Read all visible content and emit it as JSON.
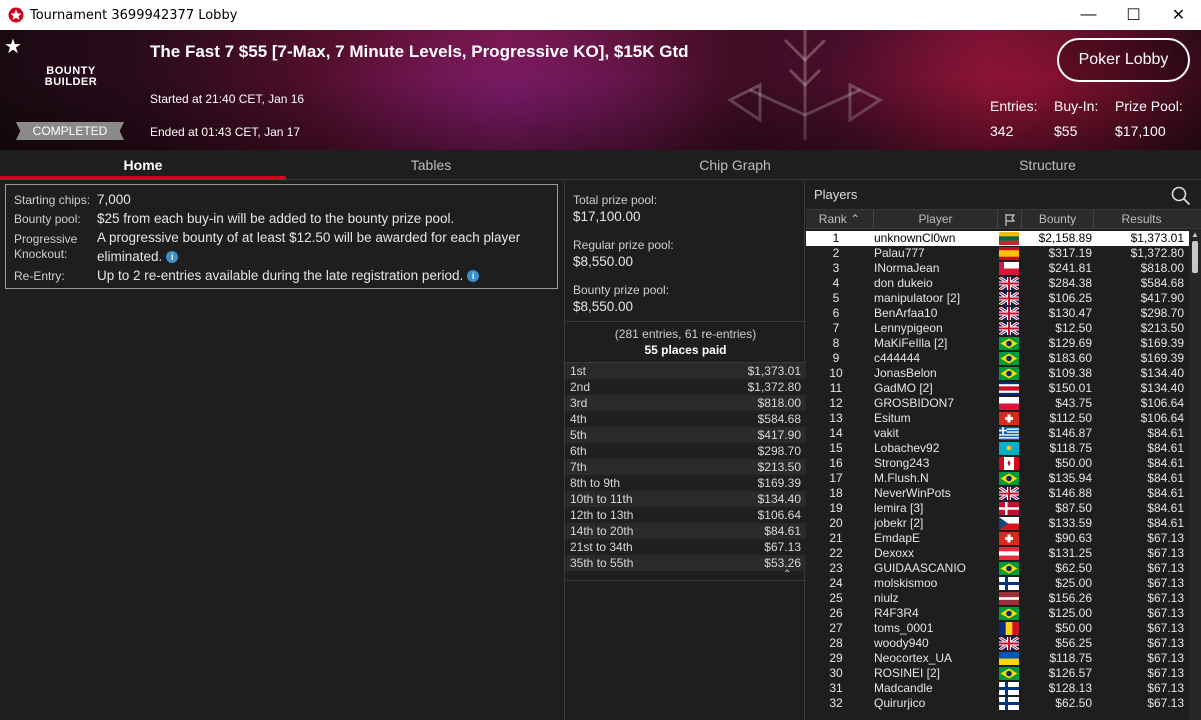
{
  "window": {
    "title": "Tournament 3699942377 Lobby",
    "controls": [
      "—",
      "☐",
      "✕"
    ]
  },
  "banner": {
    "brand_logo_line1": "BOUNTY",
    "brand_logo_line2": "BUILDER",
    "status": "COMPLETED",
    "title": "The Fast 7 $55 [7-Max, 7 Minute Levels, Progressive KO], $15K Gtd",
    "started": "Started at 21:40 CET, Jan 16",
    "ended": "Ended at 01:43 CET, Jan 17",
    "poker_lobby_label": "Poker Lobby",
    "stats": {
      "entries_label": "Entries:",
      "entries": "342",
      "buyin_label": "Buy-In:",
      "buyin": "$55",
      "prizepool_label": "Prize Pool:",
      "prizepool": "$17,100"
    }
  },
  "tabs": [
    {
      "label": "Home",
      "active": true
    },
    {
      "label": "Tables",
      "active": false
    },
    {
      "label": "Chip Graph",
      "active": false
    },
    {
      "label": "Structure",
      "active": false
    }
  ],
  "info": {
    "starting_chips_label": "Starting chips:",
    "starting_chips": "7,000",
    "bounty_pool_label": "Bounty pool:",
    "bounty_pool": "$25 from each buy-in will be added to the bounty prize pool.",
    "progressive_label_1": "Progressive",
    "progressive_label_2": "Knockout:",
    "progressive_1": "A progressive bounty of at least $12.50 will be awarded for each player",
    "progressive_2": "eliminated.",
    "reentry_label": "Re-Entry:",
    "reentry": "Up to 2 re-entries available during the late registration period."
  },
  "prizepool": {
    "total_label": "Total prize pool:",
    "total": "$17,100.00",
    "regular_label": "Regular prize pool:",
    "regular": "$8,550.00",
    "bounty_label": "Bounty prize pool:",
    "bounty": "$8,550.00",
    "entries_note": "(281 entries, 61 re-entries)",
    "places_paid": "55 places paid",
    "payouts": [
      {
        "place": "1st",
        "amount": "$1,373.01"
      },
      {
        "place": "2nd",
        "amount": "$1,372.80"
      },
      {
        "place": "3rd",
        "amount": "$818.00"
      },
      {
        "place": "4th",
        "amount": "$584.68"
      },
      {
        "place": "5th",
        "amount": "$417.90"
      },
      {
        "place": "6th",
        "amount": "$298.70"
      },
      {
        "place": "7th",
        "amount": "$213.50"
      },
      {
        "place": "8th to 9th",
        "amount": "$169.39"
      },
      {
        "place": "10th to 11th",
        "amount": "$134.40"
      },
      {
        "place": "12th to 13th",
        "amount": "$106.64"
      },
      {
        "place": "14th to 20th",
        "amount": "$84.61"
      },
      {
        "place": "21st to 34th",
        "amount": "$67.13"
      },
      {
        "place": "35th to 55th",
        "amount": "$53.26"
      }
    ]
  },
  "players": {
    "title": "Players",
    "headers": {
      "rank": "Rank",
      "player": "Player",
      "bounty": "Bounty",
      "results": "Results"
    },
    "rows": [
      {
        "rank": "1",
        "name": "unknownCl0wn",
        "flag": "lt",
        "bounty": "$2,158.89",
        "result": "$1,373.01"
      },
      {
        "rank": "2",
        "name": "Palau777",
        "flag": "es",
        "bounty": "$317.19",
        "result": "$1,372.80"
      },
      {
        "rank": "3",
        "name": "INormaJean",
        "flag": "ca-pl",
        "bounty": "$241.81",
        "result": "$818.00"
      },
      {
        "rank": "4",
        "name": "don dukeio",
        "flag": "gb",
        "bounty": "$284.38",
        "result": "$584.68"
      },
      {
        "rank": "5",
        "name": "manipulatoor [2]",
        "flag": "gb",
        "bounty": "$106.25",
        "result": "$417.90"
      },
      {
        "rank": "6",
        "name": "BenArfaa10",
        "flag": "gb",
        "bounty": "$130.47",
        "result": "$298.70"
      },
      {
        "rank": "7",
        "name": "Lennypigeon",
        "flag": "gb",
        "bounty": "$12.50",
        "result": "$213.50"
      },
      {
        "rank": "8",
        "name": "MaKiFeIlla [2]",
        "flag": "br",
        "bounty": "$129.69",
        "result": "$169.39"
      },
      {
        "rank": "9",
        "name": "c444444",
        "flag": "br",
        "bounty": "$183.60",
        "result": "$169.39"
      },
      {
        "rank": "10",
        "name": "JonasBelon",
        "flag": "br",
        "bounty": "$109.38",
        "result": "$134.40"
      },
      {
        "rank": "11",
        "name": "GadMO [2]",
        "flag": "cr",
        "bounty": "$150.01",
        "result": "$134.40"
      },
      {
        "rank": "12",
        "name": "GROSBIDON7",
        "flag": "pl",
        "bounty": "$43.75",
        "result": "$106.64"
      },
      {
        "rank": "13",
        "name": "Esitum",
        "flag": "ch",
        "bounty": "$112.50",
        "result": "$106.64"
      },
      {
        "rank": "14",
        "name": "vakit",
        "flag": "gr",
        "bounty": "$146.87",
        "result": "$84.61"
      },
      {
        "rank": "15",
        "name": "Lobachev92",
        "flag": "kz",
        "bounty": "$118.75",
        "result": "$84.61"
      },
      {
        "rank": "16",
        "name": "Strong243",
        "flag": "ca",
        "bounty": "$50.00",
        "result": "$84.61"
      },
      {
        "rank": "17",
        "name": "M.Flush.N",
        "flag": "br",
        "bounty": "$135.94",
        "result": "$84.61"
      },
      {
        "rank": "18",
        "name": "NeverWinPots",
        "flag": "gb",
        "bounty": "$146.88",
        "result": "$84.61"
      },
      {
        "rank": "19",
        "name": "lemira [3]",
        "flag": "dk",
        "bounty": "$87.50",
        "result": "$84.61"
      },
      {
        "rank": "20",
        "name": "jobekr [2]",
        "flag": "cz",
        "bounty": "$133.59",
        "result": "$84.61"
      },
      {
        "rank": "21",
        "name": "EmdapE",
        "flag": "ch",
        "bounty": "$90.63",
        "result": "$67.13"
      },
      {
        "rank": "22",
        "name": "Dexoxx",
        "flag": "at",
        "bounty": "$131.25",
        "result": "$67.13"
      },
      {
        "rank": "23",
        "name": "GUIDAASCANIO",
        "flag": "br",
        "bounty": "$62.50",
        "result": "$67.13"
      },
      {
        "rank": "24",
        "name": "molskismoo",
        "flag": "fi",
        "bounty": "$25.00",
        "result": "$67.13"
      },
      {
        "rank": "25",
        "name": "niulz",
        "flag": "lv",
        "bounty": "$156.26",
        "result": "$67.13"
      },
      {
        "rank": "26",
        "name": "R4F3R4",
        "flag": "br",
        "bounty": "$125.00",
        "result": "$67.13"
      },
      {
        "rank": "27",
        "name": "toms_0001",
        "flag": "ro",
        "bounty": "$50.00",
        "result": "$67.13"
      },
      {
        "rank": "28",
        "name": "woody940",
        "flag": "gb",
        "bounty": "$56.25",
        "result": "$67.13"
      },
      {
        "rank": "29",
        "name": "Neocortex_UA",
        "flag": "ua",
        "bounty": "$118.75",
        "result": "$67.13"
      },
      {
        "rank": "30",
        "name": "ROSINEI [2]",
        "flag": "br",
        "bounty": "$126.57",
        "result": "$67.13"
      },
      {
        "rank": "31",
        "name": "Madcandle",
        "flag": "fi",
        "bounty": "$128.13",
        "result": "$67.13"
      },
      {
        "rank": "32",
        "name": "Quirurjico",
        "flag": "fi",
        "bounty": "$62.50",
        "result": "$67.13"
      }
    ]
  }
}
